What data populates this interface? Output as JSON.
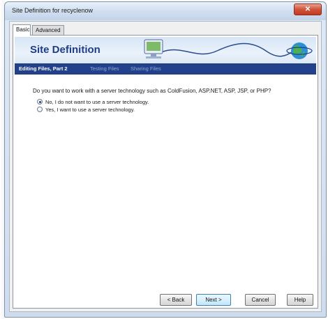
{
  "window": {
    "title": "Site Definition for recyclenow",
    "close_glyph": "✕"
  },
  "tabs": [
    {
      "label": "Basic",
      "active": true
    },
    {
      "label": "Advanced",
      "active": false
    }
  ],
  "banner": {
    "title": "Site Definition"
  },
  "steps": [
    {
      "label": "Editing Files, Part 2",
      "current": true
    },
    {
      "label": "Testing Files",
      "current": false
    },
    {
      "label": "Sharing Files",
      "current": false
    }
  ],
  "question": "Do you want to work with a server technology such as ColdFusion, ASP.NET, ASP, JSP, or PHP?",
  "options": [
    {
      "label": "No, I do not want to use a server technology.",
      "selected": true
    },
    {
      "label": "Yes, I want to use a server technology.",
      "selected": false
    }
  ],
  "buttons": {
    "back": "< Back",
    "next": "Next >",
    "cancel": "Cancel",
    "help": "Help"
  },
  "colors": {
    "banner_title": "#1d3d85",
    "step_bar": "#23408a",
    "close_button": "#c23a21"
  }
}
